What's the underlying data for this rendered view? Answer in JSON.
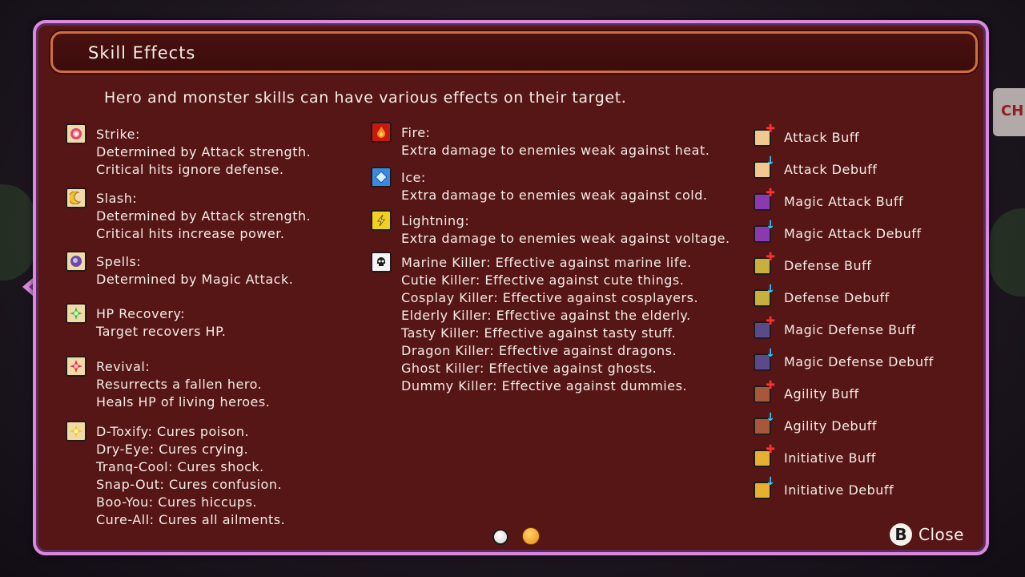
{
  "title": "Skill Effects",
  "intro": "Hero and monster skills can have various effects on their target.",
  "left_column": [
    {
      "icon": "strike-icon",
      "text": "Strike:\nDetermined by Attack strength.\nCritical hits ignore defense."
    },
    {
      "icon": "slash-icon",
      "text": "Slash:\nDetermined by Attack strength.\nCritical hits increase power."
    },
    {
      "icon": "spells-icon",
      "text": "Spells:\nDetermined by Magic Attack."
    },
    {
      "icon": "hp-recovery-icon",
      "text": "HP Recovery:\nTarget recovers HP."
    },
    {
      "icon": "revival-icon",
      "text": "Revival:\nResurrects a fallen hero.\nHeals HP of living heroes."
    },
    {
      "icon": "cure-icon",
      "text": "D-Toxify: Cures poison.\nDry-Eye: Cures crying.\nTranq-Cool: Cures shock.\nSnap-Out: Cures confusion.\nBoo-You: Cures hiccups.\nCure-All: Cures all ailments."
    }
  ],
  "middle_column": [
    {
      "icon": "fire-icon",
      "text": "Fire:\nExtra damage to enemies weak against heat."
    },
    {
      "icon": "ice-icon",
      "text": "Ice:\nExtra damage to enemies weak against cold."
    },
    {
      "icon": "lightning-icon",
      "text": "Lightning:\nExtra damage to enemies weak against voltage."
    },
    {
      "icon": "skull-icon",
      "text": "Marine Killer: Effective against marine life.\nCutie Killer: Effective against cute things.\nCosplay Killer: Effective against cosplayers.\nElderly Killer: Effective against the elderly.\nTasty Killer: Effective against tasty stuff.\nDragon Killer: Effective against dragons.\nGhost Killer: Effective against ghosts.\nDummy Killer: Effective against dummies."
    }
  ],
  "right_column": [
    {
      "icon": "attack-buff-icon",
      "label": "Attack Buff"
    },
    {
      "icon": "attack-debuff-icon",
      "label": "Attack Debuff"
    },
    {
      "icon": "magic-attack-buff-icon",
      "label": "Magic Attack Buff"
    },
    {
      "icon": "magic-attack-debuff-icon",
      "label": "Magic Attack Debuff"
    },
    {
      "icon": "defense-buff-icon",
      "label": "Defense Buff"
    },
    {
      "icon": "defense-debuff-icon",
      "label": "Defense Debuff"
    },
    {
      "icon": "magic-defense-buff-icon",
      "label": "Magic Defense Buff"
    },
    {
      "icon": "magic-defense-debuff-icon",
      "label": "Magic Defense Debuff"
    },
    {
      "icon": "agility-buff-icon",
      "label": "Agility Buff"
    },
    {
      "icon": "agility-debuff-icon",
      "label": "Agility Debuff"
    },
    {
      "icon": "initiative-buff-icon",
      "label": "Initiative Buff"
    },
    {
      "icon": "initiative-debuff-icon",
      "label": "Initiative Debuff"
    }
  ],
  "pagination": {
    "current_page": 2,
    "total_pages": 2
  },
  "close": {
    "button_glyph": "B",
    "label": "Close"
  },
  "background_sign": "CH",
  "colors": {
    "panel_bg": "#571616",
    "panel_border": "#d98ae0",
    "title_border": "#d06f3c",
    "buff_arrow": "#ff3030",
    "debuff_arrow": "#30c8ff"
  }
}
